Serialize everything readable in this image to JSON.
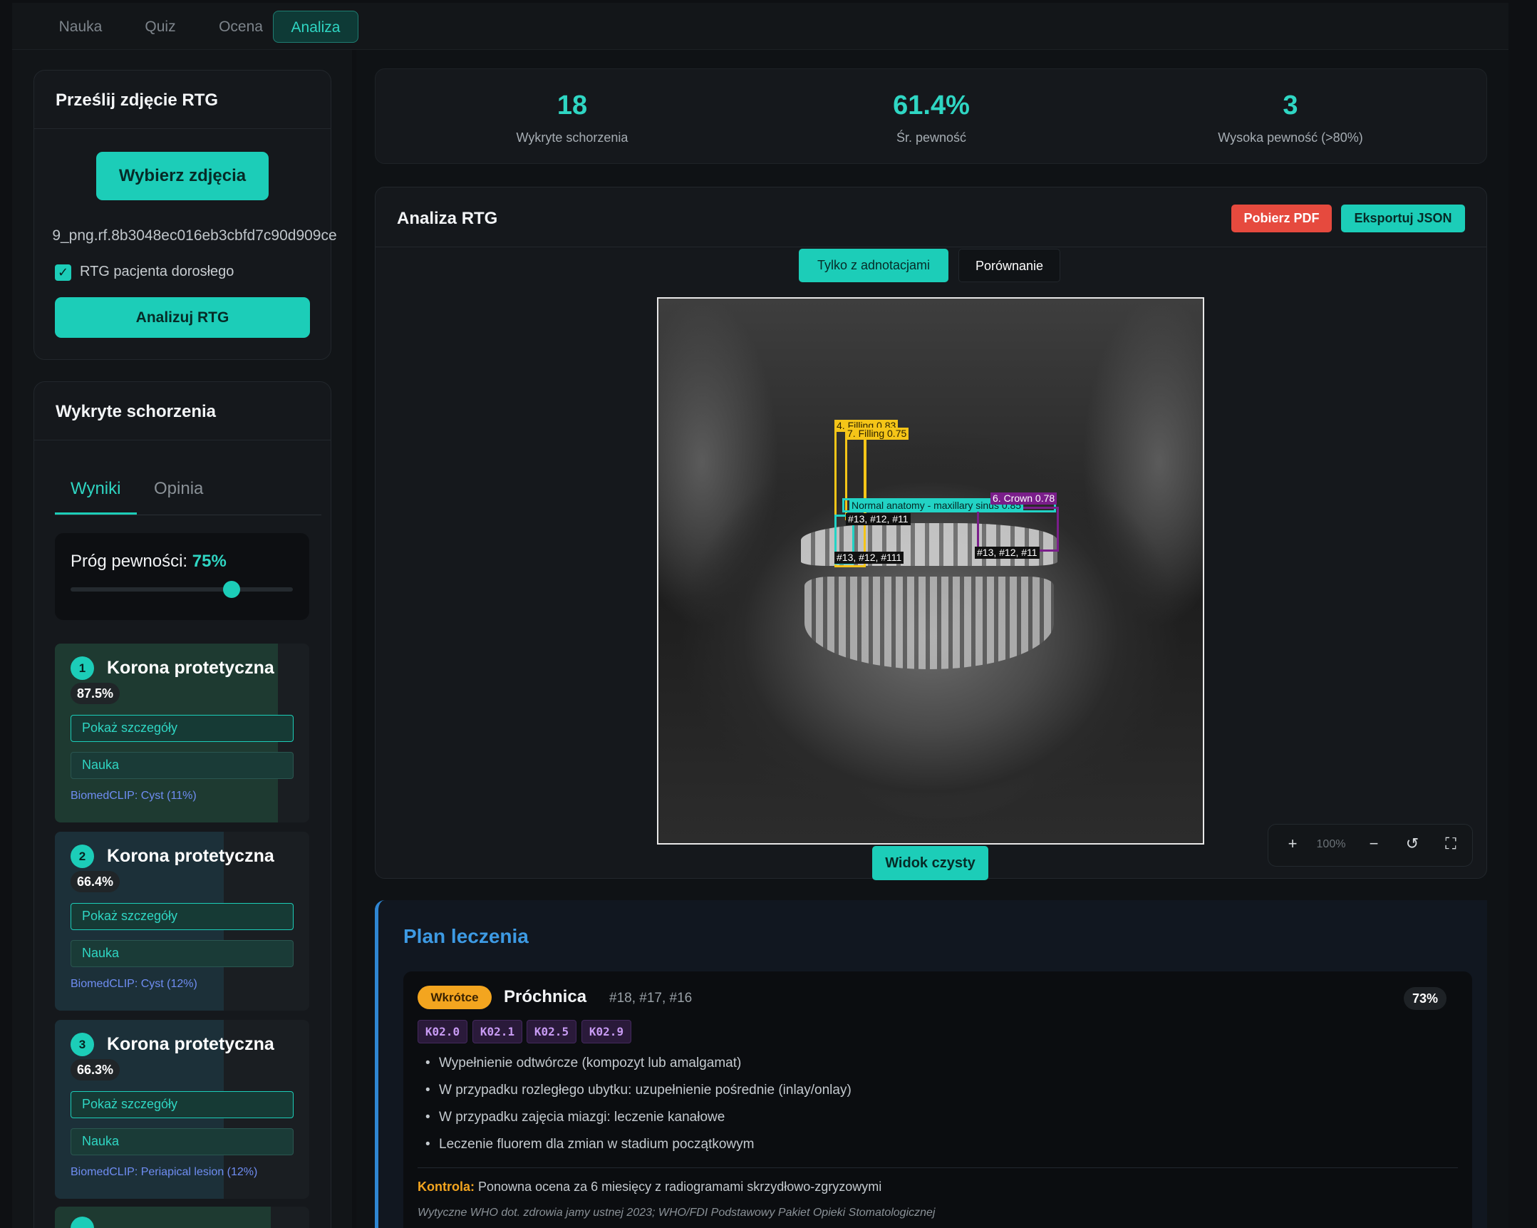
{
  "nav": {
    "tabs": [
      {
        "label": "Nauka"
      },
      {
        "label": "Quiz"
      },
      {
        "label": "Ocena"
      },
      {
        "label": "Analiza",
        "active": true
      }
    ]
  },
  "upload": {
    "title": "Prześlij zdjęcie RTG",
    "choose_button": "Wybierz zdjęcia",
    "filename": "9_png.rf.8b3048ec016eb3cbfd7c90d909ce",
    "adult_checkbox_label": "RTG pacjenta dorosłego",
    "adult_checked": true,
    "analyze_button": "Analizuj RTG"
  },
  "detections": {
    "title": "Wykryte schorzenia",
    "tabs": [
      {
        "label": "Wyniki",
        "active": true
      },
      {
        "label": "Opinia"
      }
    ],
    "threshold_label": "Próg pewności:",
    "threshold_value": "75%",
    "threshold_fraction": 0.75,
    "items": [
      {
        "number": "1",
        "name": "Korona protetyczna",
        "confidence": "87.5%",
        "confidence_fraction": 0.875,
        "details_button": "Pokaż szczegóły",
        "learn_button": "Nauka",
        "biomedclip": "BiomedCLIP: Cyst (11%)",
        "color": "#1e4a3a"
      },
      {
        "number": "2",
        "name": "Korona protetyczna",
        "confidence": "66.4%",
        "confidence_fraction": 0.664,
        "details_button": "Pokaż szczegóły",
        "learn_button": "Nauka",
        "biomedclip": "BiomedCLIP: Cyst (12%)",
        "color": "#1d3b44"
      },
      {
        "number": "3",
        "name": "Korona protetyczna",
        "confidence": "66.3%",
        "confidence_fraction": 0.663,
        "details_button": "Pokaż szczegóły",
        "learn_button": "Nauka",
        "biomedclip": "BiomedCLIP: Periapical lesion (12%)",
        "color": "#1d3b44"
      }
    ]
  },
  "stats": [
    {
      "value": "18",
      "label": "Wykryte schorzenia"
    },
    {
      "value": "61.4%",
      "label": "Śr. pewność"
    },
    {
      "value": "3",
      "label": "Wysoka pewność (>80%)"
    }
  ],
  "analysis": {
    "title": "Analiza RTG",
    "pdf_button": "Pobierz PDF",
    "json_button": "Eksportuj JSON",
    "view_annotated": "Tylko z adnotacjami",
    "view_compare": "Porównanie",
    "clean_view_button": "Widok czysty",
    "zoom": {
      "plus": "+",
      "level": "100%",
      "minus": "−",
      "reset": "↺",
      "fullscreen": "⛶"
    },
    "annotations": [
      {
        "label": "4. Filling 0.83",
        "color": "#f5c518"
      },
      {
        "label": "7. Filling 0.75",
        "color": "#f5c518"
      },
      {
        "label": "Normal anatomy - maxillary sinus 0.85",
        "color": "#22d3c5"
      },
      {
        "label": "6. Crown 0.78",
        "color": "#7a1e8a"
      },
      {
        "label": "#13, #12, #11",
        "color": "#111111"
      },
      {
        "label": "#13, #12, #111",
        "color": "#111111"
      },
      {
        "label": "#13, #12, #11",
        "color": "#111111"
      }
    ]
  },
  "plan": {
    "title": "Plan leczenia",
    "item": {
      "badge": "Wkrótce",
      "name": "Próchnica",
      "teeth": "#18, #17, #16",
      "confidence": "73%",
      "codes": [
        "K02.0",
        "K02.1",
        "K02.5",
        "K02.9"
      ],
      "steps": [
        "Wypełnienie odtwórcze (kompozyt lub amalgamat)",
        "W przypadku rozległego ubytku: uzupełnienie pośrednie (inlay/onlay)",
        "W przypadku zajęcia miazgi: leczenie kanałowe",
        "Leczenie fluorem dla zmian w stadium początkowym"
      ],
      "followup_label": "Kontrola:",
      "followup_text": "Ponowna ocena za 6 miesięcy z radiogramami skrzydłowo-zgryzowymi",
      "guidelines": "Wytyczne WHO dot. zdrowia jamy ustnej 2023; WHO/FDI Podstawowy Pakiet Opieki Stomatologicznej"
    }
  }
}
